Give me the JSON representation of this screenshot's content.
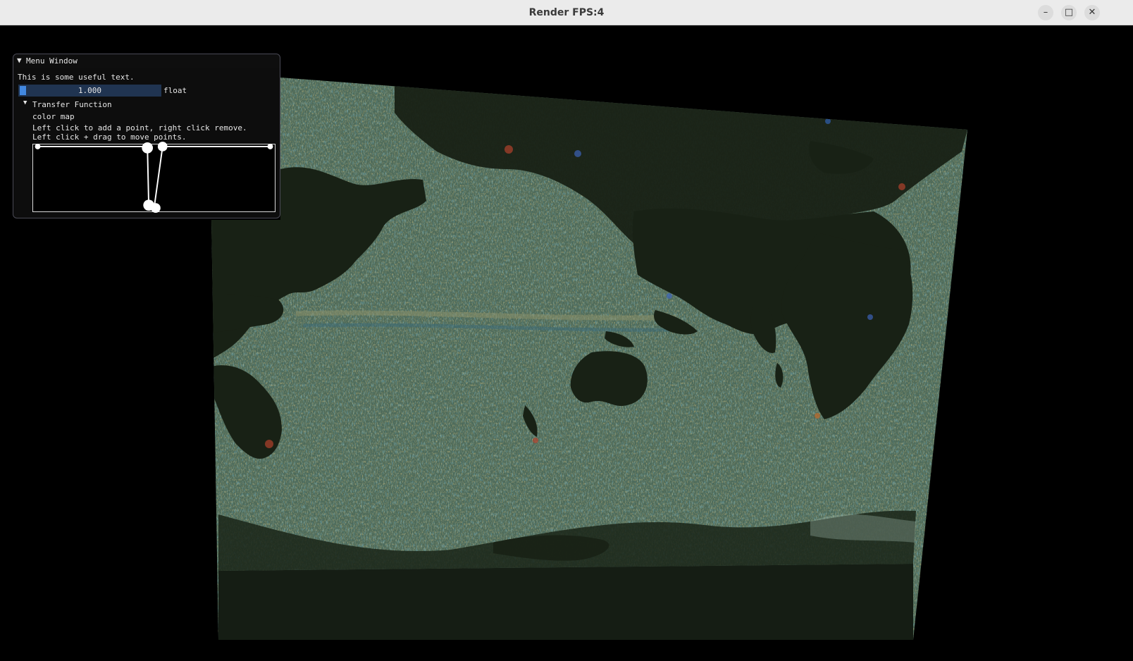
{
  "window": {
    "title": "Render FPS:4",
    "minimize_glyph": "–",
    "maximize_glyph": "□",
    "close_glyph": "✕"
  },
  "menu": {
    "title": "Menu Window",
    "collapse_glyph": "▼",
    "useful_text": "This is some useful text.",
    "slider": {
      "value_text": "1.000",
      "label": "float",
      "value": 1.0
    },
    "transfer_function": {
      "header": "Transfer Function",
      "collapse_glyph": "▼",
      "subtitle": "color map",
      "hint_line1": "Left click to add a point, right click remove.",
      "hint_line2": "Left click + drag to move points."
    }
  },
  "colors": {
    "titlebar": "#ebebeb",
    "viewport": "#000000",
    "ocean_tint": "#5d7e6c",
    "land": "#182115",
    "slider_bg": "#203451",
    "slider_grab": "#4288e0"
  },
  "icons": {
    "minimize": "minimize-icon",
    "maximize": "maximize-icon",
    "close": "close-icon",
    "collapse": "triangle-down-icon"
  }
}
